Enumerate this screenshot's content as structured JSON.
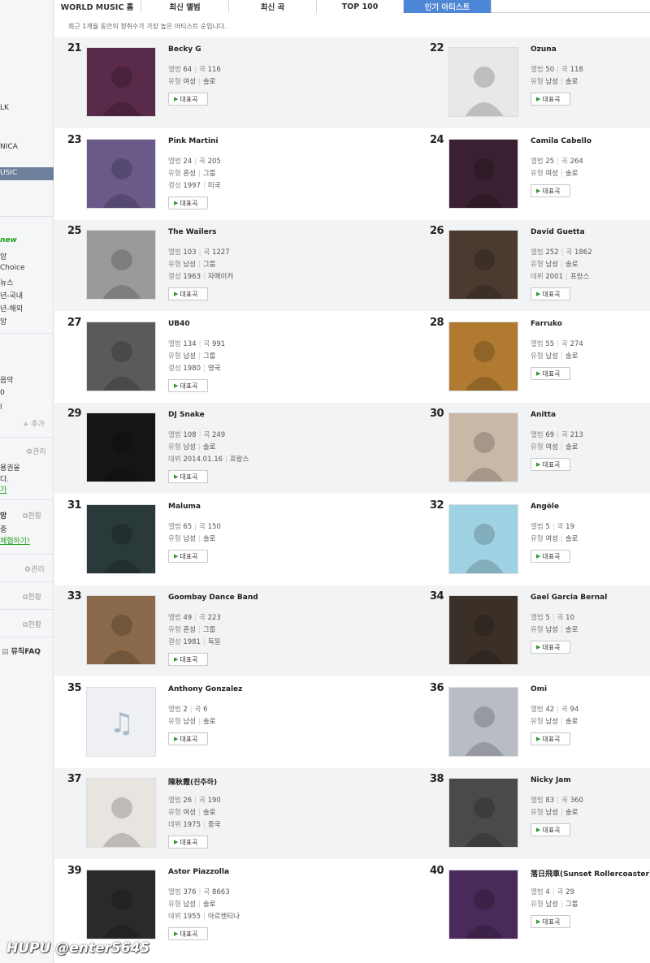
{
  "tabs": [
    {
      "label": "WORLD MUSIC 홈",
      "active": false
    },
    {
      "label": "최신 앨범",
      "active": false
    },
    {
      "label": "최신 곡",
      "active": false
    },
    {
      "label": "TOP 100",
      "active": false
    },
    {
      "label": "인기 아티스트",
      "active": true
    }
  ],
  "subtitle": "최근 1개월 동안의 청취수가 가장 높은 아티스트 순입니다.",
  "sidebar": {
    "items": [
      "LK",
      "NICA",
      "USIC",
      "new",
      "앙",
      "Choice",
      "뉴스",
      "년-국내",
      "년-해외",
      "앙",
      "음악",
      "0",
      "l"
    ],
    "add": "+ 추가",
    "manage1": "관리",
    "promo1": "용권을",
    "promo2": "다.",
    "promo_link": "가",
    "status1_title": "앙",
    "status_label": "현황",
    "promo3": "중",
    "promo3_link": "체험하기!",
    "manage2": "관리",
    "status2": "현황",
    "status3": "현황",
    "faq": "뮤직FAQ"
  },
  "labels": {
    "album": "앨범",
    "song": "곡",
    "type": "유형",
    "formed": "결성",
    "debut": "데뷔",
    "button": "대표곡"
  },
  "artists": [
    {
      "rank": "21",
      "name": "Becky G",
      "albums": "64",
      "songs": "116",
      "type": "여성",
      "kind": "솔로",
      "year_label": "",
      "year": "",
      "country": "",
      "color": "#5a2a4a"
    },
    {
      "rank": "22",
      "name": "Ozuna",
      "albums": "50",
      "songs": "118",
      "type": "남성",
      "kind": "솔로",
      "year_label": "",
      "year": "",
      "country": "",
      "color": "#e8e8e8"
    },
    {
      "rank": "23",
      "name": "Pink Martini",
      "albums": "24",
      "songs": "205",
      "type": "혼성",
      "kind": "그룹",
      "year_label": "결성",
      "year": "1997",
      "country": "미국",
      "color": "#6a5a8a"
    },
    {
      "rank": "24",
      "name": "Camila Cabello",
      "albums": "25",
      "songs": "264",
      "type": "여성",
      "kind": "솔로",
      "year_label": "",
      "year": "",
      "country": "",
      "color": "#3a2030"
    },
    {
      "rank": "25",
      "name": "The Wailers",
      "albums": "103",
      "songs": "1227",
      "type": "남성",
      "kind": "그룹",
      "year_label": "결성",
      "year": "1963",
      "country": "자메이카",
      "color": "#9a9a9a"
    },
    {
      "rank": "26",
      "name": "David Guetta",
      "albums": "252",
      "songs": "1862",
      "type": "남성",
      "kind": "솔로",
      "year_label": "데뷔",
      "year": "2001",
      "country": "프랑스",
      "color": "#4a3a30"
    },
    {
      "rank": "27",
      "name": "UB40",
      "albums": "134",
      "songs": "991",
      "type": "남성",
      "kind": "그룹",
      "year_label": "결성",
      "year": "1980",
      "country": "영국",
      "color": "#5a5a5a"
    },
    {
      "rank": "28",
      "name": "Farruko",
      "albums": "55",
      "songs": "274",
      "type": "남성",
      "kind": "솔로",
      "year_label": "",
      "year": "",
      "country": "",
      "color": "#b07a30"
    },
    {
      "rank": "29",
      "name": "DJ Snake",
      "albums": "108",
      "songs": "249",
      "type": "남성",
      "kind": "솔로",
      "year_label": "데뷔",
      "year": "2014.01.16",
      "country": "프랑스",
      "color": "#151515"
    },
    {
      "rank": "30",
      "name": "Anitta",
      "albums": "69",
      "songs": "213",
      "type": "여성",
      "kind": "솔로",
      "year_label": "",
      "year": "",
      "country": "",
      "color": "#c8b8a8"
    },
    {
      "rank": "31",
      "name": "Maluma",
      "albums": "65",
      "songs": "150",
      "type": "남성",
      "kind": "솔로",
      "year_label": "",
      "year": "",
      "country": "",
      "color": "#2a3a3a"
    },
    {
      "rank": "32",
      "name": "Angèle",
      "albums": "5",
      "songs": "19",
      "type": "여성",
      "kind": "솔로",
      "year_label": "",
      "year": "",
      "country": "",
      "color": "#9fd3e4"
    },
    {
      "rank": "33",
      "name": "Goombay Dance Band",
      "albums": "49",
      "songs": "223",
      "type": "혼성",
      "kind": "그룹",
      "year_label": "결성",
      "year": "1981",
      "country": "독일",
      "color": "#8a6a4a"
    },
    {
      "rank": "34",
      "name": "Gael Garcia Bernal",
      "albums": "5",
      "songs": "10",
      "type": "남성",
      "kind": "솔로",
      "year_label": "",
      "year": "",
      "country": "",
      "color": "#3a3028"
    },
    {
      "rank": "35",
      "name": "Anthony Gonzalez",
      "albums": "2",
      "songs": "6",
      "type": "남성",
      "kind": "솔로",
      "year_label": "",
      "year": "",
      "country": "",
      "color": "#eef0f4"
    },
    {
      "rank": "36",
      "name": "Omi",
      "albums": "42",
      "songs": "94",
      "type": "남성",
      "kind": "솔로",
      "year_label": "",
      "year": "",
      "country": "",
      "color": "#b8bcc4"
    },
    {
      "rank": "37",
      "name": "陳秋霞(진추하)",
      "albums": "26",
      "songs": "190",
      "type": "여성",
      "kind": "솔로",
      "year_label": "데뷔",
      "year": "1975",
      "country": "중국",
      "color": "#e8e4e0"
    },
    {
      "rank": "38",
      "name": "Nicky Jam",
      "albums": "83",
      "songs": "360",
      "type": "남성",
      "kind": "솔로",
      "year_label": "",
      "year": "",
      "country": "",
      "color": "#4a4a4a"
    },
    {
      "rank": "39",
      "name": "Astor Piazzolla",
      "albums": "376",
      "songs": "8663",
      "type": "남성",
      "kind": "솔로",
      "year_label": "데뷔",
      "year": "1955",
      "country": "아르헨티나",
      "color": "#2a2a2a"
    },
    {
      "rank": "40",
      "name": "落日飛車(Sunset Rollercoaster)",
      "albums": "4",
      "songs": "29",
      "type": "남성",
      "kind": "그룹",
      "year_label": "",
      "year": "",
      "country": "",
      "color": "#4a2a5a"
    }
  ],
  "watermark": "HUPU @enter5645"
}
